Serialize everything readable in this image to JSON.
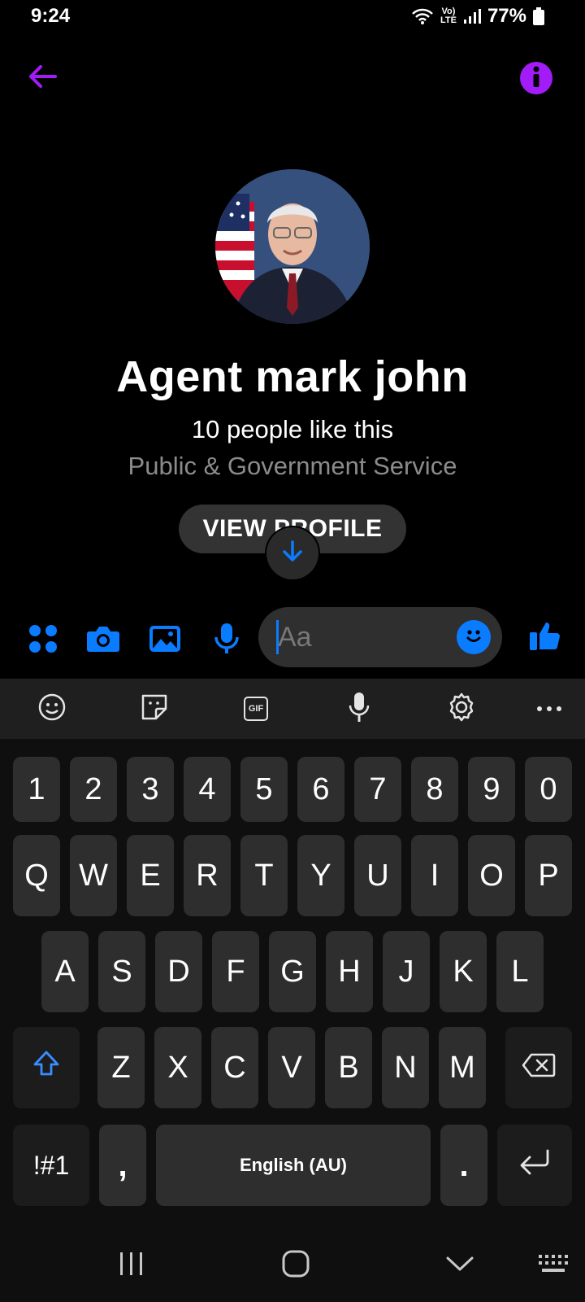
{
  "status_bar": {
    "time": "9:24",
    "network_top": "Vo)",
    "network_bottom": "LTE",
    "battery": "77%"
  },
  "header": {
    "back_icon": "arrow-left-icon",
    "info_icon": "info-icon",
    "accent": "#a11cf7"
  },
  "profile": {
    "name": "Agent mark john",
    "likes": "10 people like this",
    "category": "Public & Government Service",
    "view_profile_label": "VIEW PROFILE"
  },
  "composer": {
    "placeholder": "Aa",
    "icons": [
      "menu-dots-icon",
      "camera-icon",
      "gallery-icon",
      "microphone-icon",
      "emoji-icon",
      "thumbs-up-icon"
    ],
    "accent": "#0a7cff"
  },
  "keyboard": {
    "toolbar_icons": [
      "emoji-icon",
      "sticker-icon",
      "gif-icon",
      "microphone-icon",
      "settings-icon",
      "more-icon"
    ],
    "gif_label": "GIF",
    "rows": [
      [
        "1",
        "2",
        "3",
        "4",
        "5",
        "6",
        "7",
        "8",
        "9",
        "0"
      ],
      [
        "Q",
        "W",
        "E",
        "R",
        "T",
        "Y",
        "U",
        "I",
        "O",
        "P"
      ],
      [
        "A",
        "S",
        "D",
        "F",
        "G",
        "H",
        "J",
        "K",
        "L"
      ],
      [
        "Z",
        "X",
        "C",
        "V",
        "B",
        "N",
        "M"
      ]
    ],
    "symbols_label": "!#1",
    "comma_label": ",",
    "space_label": "English (AU)",
    "period_label": "."
  },
  "nav_bar": {
    "icons": [
      "recent-apps-icon",
      "home-icon",
      "back-chevron-icon",
      "keyboard-toggle-icon"
    ]
  }
}
